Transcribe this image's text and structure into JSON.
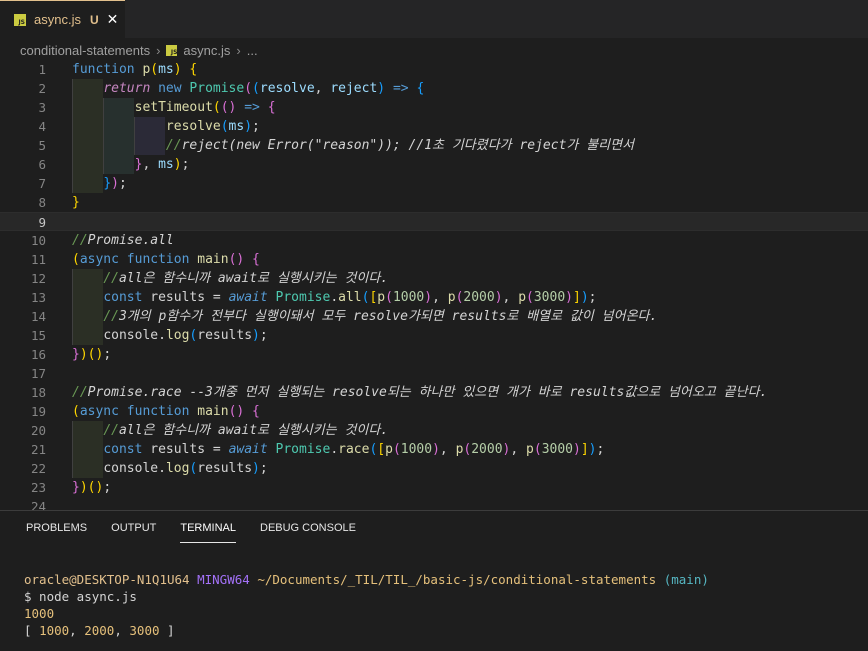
{
  "tab": {
    "file_name": "async.js",
    "status": "U",
    "close": "✕",
    "badge": "JS"
  },
  "breadcrumb": {
    "folder": "conditional-statements",
    "file": "async.js",
    "more": "..."
  },
  "editor": {
    "line_numbers": [
      "1",
      "2",
      "3",
      "4",
      "5",
      "6",
      "7",
      "8",
      "9",
      "10",
      "11",
      "12",
      "13",
      "14",
      "15",
      "16",
      "17",
      "18",
      "19",
      "20",
      "21",
      "22",
      "23",
      "24"
    ],
    "current_line": 9
  },
  "code": {
    "l13": {
      "results": "results",
      "all": "all",
      "n1": "1000",
      "n2": "2000",
      "n3": "3000"
    },
    "l21": {
      "race": "race",
      "n1": "1000",
      "n2": "2000",
      "n3": "3000"
    }
  },
  "panel": {
    "tabs": [
      "PROBLEMS",
      "OUTPUT",
      "TERMINAL",
      "DEBUG CONSOLE"
    ],
    "active_tab": "TERMINAL"
  },
  "terminal": {
    "user_host": "oracle@DESKTOP-N1Q1U64",
    "shell": "MINGW64",
    "path": "~/Documents/_TIL/TIL_/basic-js/conditional-statements",
    "branch": "(main)",
    "command": "$ node async.js",
    "output1": "1000",
    "output2_open": "[ ",
    "output2_values": [
      "1000",
      "2000",
      "3000"
    ],
    "output2_close": " ]"
  }
}
